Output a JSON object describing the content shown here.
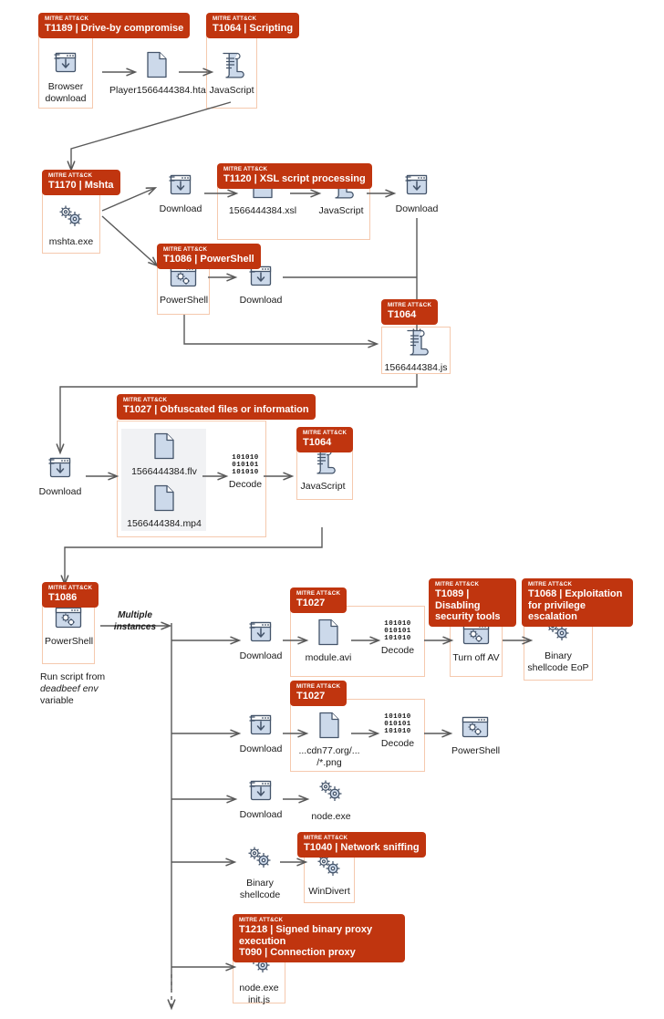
{
  "title": "MITRE ATT&CK attack-chain flow diagram",
  "badge_prefix": "MITRE ATT&CK",
  "colors": {
    "badge_bg": "#c0350f",
    "badge_text": "#ffffff",
    "group_border": "#f5c9ae",
    "icon_fill": "#ccd9ea",
    "icon_stroke": "#44546a",
    "wire": "#595959",
    "shade_bg": "#f1f2f4"
  },
  "badges": [
    {
      "id": "t1189",
      "top": "MITRE ATT&CK",
      "main": "T1189 | Drive-by compromise"
    },
    {
      "id": "t1064a",
      "top": "MITRE ATT&CK",
      "main": "T1064 | Scripting"
    },
    {
      "id": "t1170",
      "top": "MITRE ATT&CK",
      "main": "T1170 | Mshta"
    },
    {
      "id": "t1120",
      "top": "MITRE ATT&CK",
      "main": "T1120 | XSL script processing"
    },
    {
      "id": "t1086a",
      "top": "MITRE ATT&CK",
      "main": "T1086 | PowerShell"
    },
    {
      "id": "t1064b",
      "top": "MITRE ATT&CK",
      "main": "T1064"
    },
    {
      "id": "t1027a",
      "top": "MITRE ATT&CK",
      "main": "T1027 | Obfuscated files or information"
    },
    {
      "id": "t1064c",
      "top": "MITRE ATT&CK",
      "main": "T1064"
    },
    {
      "id": "t1086b",
      "top": "MITRE ATT&CK",
      "main": "T1086"
    },
    {
      "id": "t1027b",
      "top": "MITRE ATT&CK",
      "main": "T1027"
    },
    {
      "id": "t1089",
      "top": "MITRE ATT&CK",
      "main": "T1089 | Disabling security tools"
    },
    {
      "id": "t1068",
      "top": "MITRE ATT&CK",
      "main": "T1068 | Exploitation for privilege escalation"
    },
    {
      "id": "t1027c",
      "top": "MITRE ATT&CK",
      "main": "T1027"
    },
    {
      "id": "t1040",
      "top": "MITRE ATT&CK",
      "main": "T1040 | Network sniffing"
    },
    {
      "id": "t1218",
      "top": "MITRE ATT&CK",
      "main": "T1218 | Signed binary proxy execution\nT090 | Connection proxy"
    }
  ],
  "nodes": [
    {
      "id": "browser_download",
      "icon": "download-icon",
      "label": "Browser\ndownload"
    },
    {
      "id": "player_hta",
      "icon": "file-icon",
      "label": "Player1566444384.hta"
    },
    {
      "id": "javascript_1",
      "icon": "script-scroll-icon",
      "label": "JavaScript"
    },
    {
      "id": "mshta_exe",
      "icon": "gears-icon",
      "label": "mshta.exe"
    },
    {
      "id": "download_xsl",
      "icon": "download-icon",
      "label": "Download"
    },
    {
      "id": "xsl_file",
      "icon": "file-icon",
      "label": "1566444384.xsl"
    },
    {
      "id": "javascript_2",
      "icon": "script-scroll-icon",
      "label": "JavaScript"
    },
    {
      "id": "download_js",
      "icon": "download-icon",
      "label": "Download"
    },
    {
      "id": "powershell_1",
      "icon": "powershell-window-icon",
      "label": "PowerShell"
    },
    {
      "id": "download_ps",
      "icon": "download-icon",
      "label": "Download"
    },
    {
      "id": "js_file",
      "icon": "script-scroll-icon",
      "label": "1566444384.js"
    },
    {
      "id": "download_media",
      "icon": "download-icon",
      "label": "Download"
    },
    {
      "id": "flv_file",
      "icon": "file-icon",
      "label": "1566444384.flv"
    },
    {
      "id": "mp4_file",
      "icon": "file-icon",
      "label": "1566444384.mp4"
    },
    {
      "id": "decode_1",
      "icon": "binary-decode-icon",
      "label": "Decode"
    },
    {
      "id": "javascript_3",
      "icon": "script-scroll-icon",
      "label": "JavaScript"
    },
    {
      "id": "powershell_2",
      "icon": "powershell-window-icon",
      "label": "PowerShell"
    },
    {
      "id": "download_module",
      "icon": "download-icon",
      "label": "Download"
    },
    {
      "id": "module_avi",
      "icon": "file-icon",
      "label": "module.avi"
    },
    {
      "id": "decode_2",
      "icon": "binary-decode-icon",
      "label": "Decode"
    },
    {
      "id": "turn_off_av",
      "icon": "gears-window-icon",
      "label": "Turn off AV"
    },
    {
      "id": "binary_shellcode_eop",
      "icon": "gears-icon",
      "label": "Binary\nshellcode EoP"
    },
    {
      "id": "download_png",
      "icon": "download-icon",
      "label": "Download"
    },
    {
      "id": "cdn_png",
      "icon": "file-icon",
      "label": "...cdn77.org/...\n/*.png"
    },
    {
      "id": "decode_3",
      "icon": "binary-decode-icon",
      "label": "Decode"
    },
    {
      "id": "powershell_3",
      "icon": "powershell-window-icon",
      "label": "PowerShell"
    },
    {
      "id": "download_node",
      "icon": "download-icon",
      "label": "Download"
    },
    {
      "id": "node_exe",
      "icon": "gears-icon",
      "label": "node.exe"
    },
    {
      "id": "binary_shellcode",
      "icon": "gears-icon",
      "label": "Binary\nshellcode"
    },
    {
      "id": "windivert",
      "icon": "gears-icon",
      "label": "WinDivert"
    },
    {
      "id": "node_exe_init",
      "icon": "gears-icon",
      "label": "node.exe\ninit.js"
    }
  ],
  "annotations": [
    {
      "id": "multiple_instances",
      "text": "Multiple\ninstances"
    },
    {
      "id": "deadbeef_note_l1",
      "text": "Run script from"
    },
    {
      "id": "deadbeef_note_l2",
      "text": "deadbeef env"
    },
    {
      "id": "deadbeef_note_l3",
      "text": "variable"
    }
  ],
  "binary_text": "101010\n010101\n101010",
  "decode_label": "Decode"
}
